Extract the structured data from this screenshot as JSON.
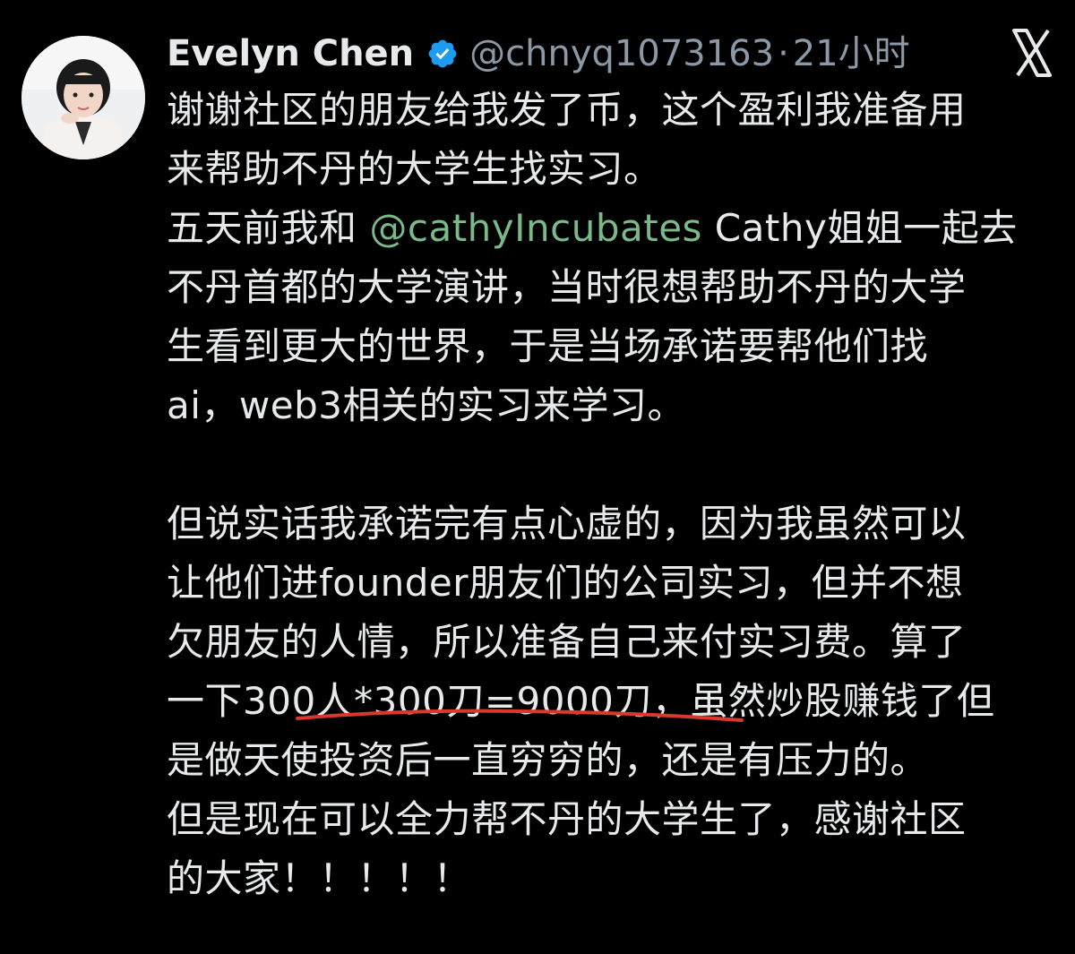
{
  "author": {
    "name": "Evelyn Chen",
    "handle": "@chnyq1073163",
    "separator": "·",
    "time": "21小时",
    "verified_icon": "verified-badge-icon",
    "accent_color": "#1d9bf0"
  },
  "close_icon": "x-logo-icon",
  "tweet": {
    "lines": [
      "谢谢社区的朋友给我发了币，这个盈利我准备用",
      "来帮助不丹的大学生找实习。"
    ],
    "line3_prefix": "五天前我和 ",
    "line3_mention": "@cathyIncubates",
    "line3_suffix": " Cathy姐姐一起去",
    "lines2": [
      "不丹首都的大学演讲，当时很想帮助不丹的大学",
      "生看到更大的世界，于是当场承诺要帮他们找",
      "ai，web3相关的实习来学习。"
    ],
    "lines3": [
      "但说实话我承诺完有点心虚的，因为我虽然可以",
      "让他们进founder朋友们的公司实习，但并不想",
      "欠朋友的人情，所以准备自己来付实习费。算了"
    ],
    "calc_line": "一下300人*300刀=9000刀，虽然炒股赚钱了但",
    "lines4": [
      "是做天使投资后一直穷穷的，还是有压力的。",
      "但是现在可以全力帮不丹的大学生了，感谢社区",
      "的大家！！！！！"
    ],
    "mention_color": "#7bb98a",
    "underline_color": "#d9382b"
  }
}
